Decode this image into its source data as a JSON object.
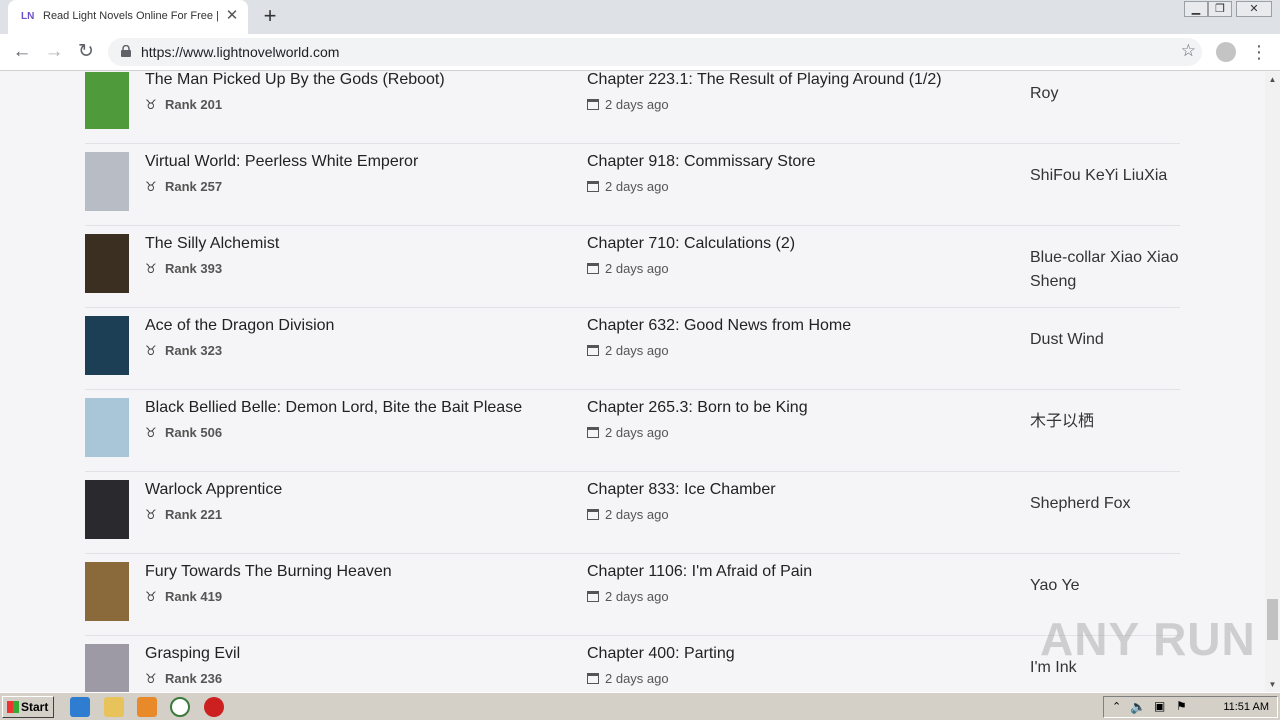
{
  "browser": {
    "tab": {
      "favicon_text": "LN",
      "title": "Read Light Novels Online For Free |"
    },
    "url": "https://www.lightnovelworld.com"
  },
  "novels": [
    {
      "title": "The Man Picked Up By the Gods (Reboot)",
      "rank": "Rank 201",
      "chapter": "Chapter 223.1: The Result of Playing Around (1/2)",
      "updated": "2 days ago",
      "author": "Roy",
      "cover_color": "#4f9a3a"
    },
    {
      "title": "Virtual World: Peerless White Emperor",
      "rank": "Rank 257",
      "chapter": "Chapter 918: Commissary Store",
      "updated": "2 days ago",
      "author": "ShiFou KeYi LiuXia",
      "cover_color": "#b8bcc4"
    },
    {
      "title": "The Silly Alchemist",
      "rank": "Rank 393",
      "chapter": "Chapter 710: Calculations (2)",
      "updated": "2 days ago",
      "author": "Blue-collar Xiao Xiao Sheng",
      "cover_color": "#3b2f22"
    },
    {
      "title": "Ace of the Dragon Division",
      "rank": "Rank 323",
      "chapter": "Chapter 632: Good News from Home",
      "updated": "2 days ago",
      "author": "Dust Wind",
      "cover_color": "#1c3f55"
    },
    {
      "title": "Black Bellied Belle: Demon Lord, Bite the Bait Please",
      "rank": "Rank 506",
      "chapter": "Chapter 265.3: Born to be King",
      "updated": "2 days ago",
      "author": "木子以栖",
      "cover_color": "#a9c6d8"
    },
    {
      "title": "Warlock Apprentice",
      "rank": "Rank 221",
      "chapter": "Chapter 833: Ice Chamber",
      "updated": "2 days ago",
      "author": "Shepherd Fox",
      "cover_color": "#2a2a2e"
    },
    {
      "title": "Fury Towards The Burning Heaven",
      "rank": "Rank 419",
      "chapter": "Chapter 1106: I'm Afraid of Pain",
      "updated": "2 days ago",
      "author": "Yao Ye",
      "cover_color": "#8a6a3a"
    },
    {
      "title": "Grasping Evil",
      "rank": "Rank 236",
      "chapter": "Chapter 400: Parting",
      "updated": "2 days ago",
      "author": "I'm Ink",
      "cover_color": "#9d9aa6"
    }
  ],
  "watermark": "ANY RUN",
  "taskbar": {
    "start_label": "Start",
    "clock": "11:51 AM"
  }
}
